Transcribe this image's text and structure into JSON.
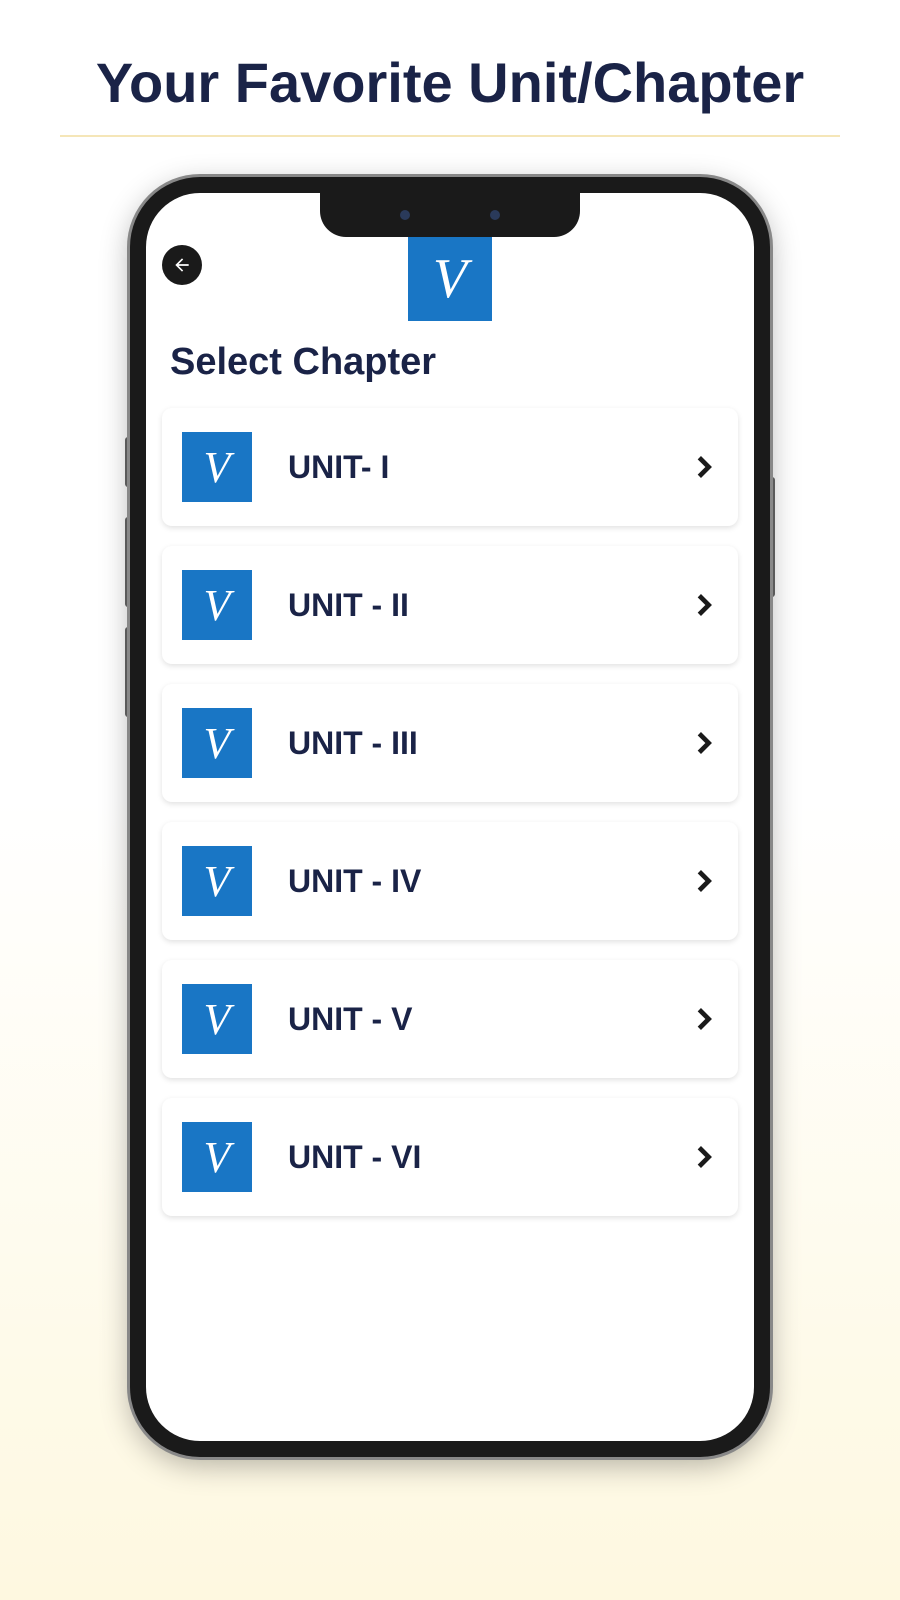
{
  "page": {
    "title": "Your Favorite Unit/Chapter"
  },
  "app": {
    "logo_letter": "V",
    "heading": "Select Chapter",
    "chapters": [
      {
        "label": "UNIT- I"
      },
      {
        "label": "UNIT - II"
      },
      {
        "label": "UNIT - III"
      },
      {
        "label": "UNIT - IV"
      },
      {
        "label": "UNIT - V"
      },
      {
        "label": "UNIT - VI"
      }
    ]
  }
}
